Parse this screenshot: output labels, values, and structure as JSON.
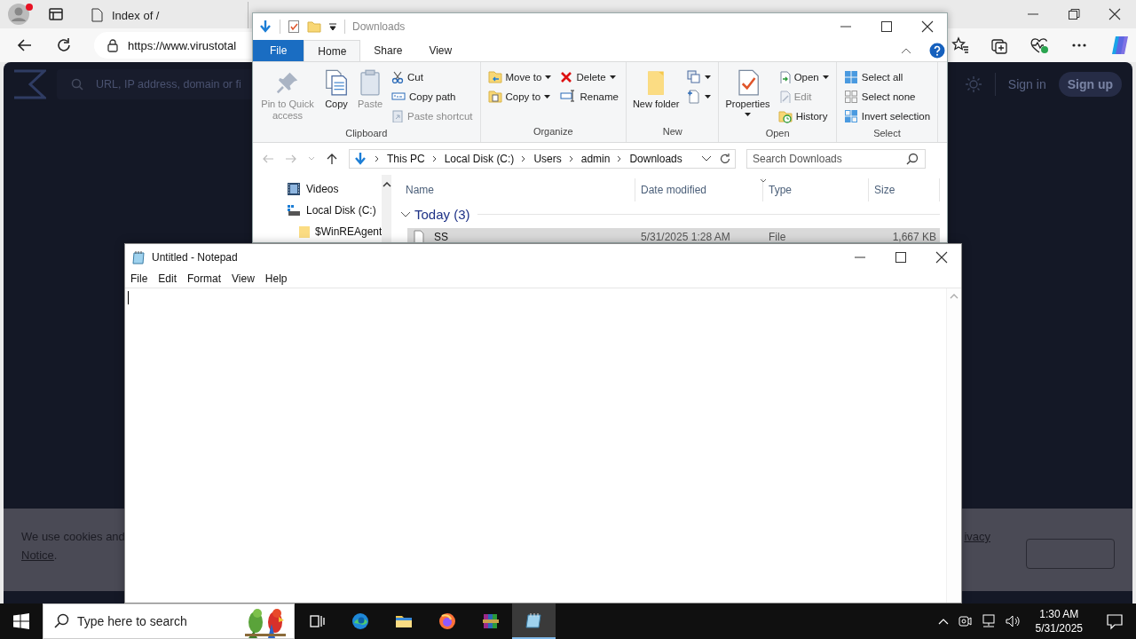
{
  "browser": {
    "tabs": [
      {
        "title": "Index of /",
        "selected": false
      }
    ],
    "address": "https://www.virustotal",
    "page": {
      "search_placeholder": "URL, IP address, domain or fi",
      "sign_in": "Sign in",
      "sign_up": "Sign up",
      "cookie": {
        "text": "We use cookies and",
        "link": "Notice",
        "after_link": ".",
        "right_link": "ivacy"
      }
    }
  },
  "explorer": {
    "title": "Downloads",
    "ribbon_tabs": [
      {
        "label": "File",
        "kind": "file",
        "selected": false
      },
      {
        "label": "Home",
        "kind": "tab",
        "selected": true
      },
      {
        "label": "Share",
        "kind": "tab",
        "selected": false
      },
      {
        "label": "View",
        "kind": "tab",
        "selected": false
      }
    ],
    "groups": [
      {
        "name": "Clipboard",
        "items": [
          {
            "kind": "large",
            "label": "Pin to Quick access",
            "disabled": true
          },
          {
            "kind": "large",
            "label": "Copy",
            "disabled": false
          },
          {
            "kind": "large",
            "label": "Paste",
            "disabled": true
          },
          {
            "kind": "stack",
            "items": [
              {
                "label": "Cut",
                "disabled": false
              },
              {
                "label": "Copy path",
                "disabled": false
              },
              {
                "label": "Paste shortcut",
                "disabled": true
              }
            ]
          }
        ]
      },
      {
        "name": "Organize",
        "items": [
          {
            "kind": "stack",
            "items": [
              {
                "label": "Move to",
                "dropdown": true
              },
              {
                "label": "Copy to",
                "dropdown": true
              }
            ]
          },
          {
            "kind": "stack",
            "items": [
              {
                "label": "Delete",
                "dropdown": true
              },
              {
                "label": "Rename"
              }
            ]
          }
        ]
      },
      {
        "name": "New",
        "items": [
          {
            "kind": "large",
            "label": "New folder",
            "disabled": false
          },
          {
            "kind": "stack",
            "items": [
              {
                "dropdown": true
              },
              {
                "dropdown": true
              }
            ]
          }
        ]
      },
      {
        "name": "Open",
        "items": [
          {
            "kind": "large",
            "label": "Properties",
            "dropdown": true,
            "disabled": false
          },
          {
            "kind": "stack",
            "items": [
              {
                "label": "Open",
                "dropdown": true
              },
              {
                "label": "Edit",
                "disabled": true
              },
              {
                "label": "History"
              }
            ]
          }
        ]
      },
      {
        "name": "Select",
        "items": [
          {
            "kind": "stack",
            "items": [
              {
                "label": "Select all"
              },
              {
                "label": "Select none"
              },
              {
                "label": "Invert selection"
              }
            ]
          }
        ]
      }
    ],
    "path": [
      "This PC",
      "Local Disk (C:)",
      "Users",
      "admin",
      "Downloads"
    ],
    "search_placeholder": "Search Downloads",
    "nav": [
      {
        "label": "Videos"
      },
      {
        "label": "Local Disk (C:)",
        "children": [
          {
            "label": "$WinREAgent"
          }
        ]
      }
    ],
    "columns": [
      {
        "label": "Name",
        "sorted": false
      },
      {
        "label": "Date modified",
        "sorted": true
      },
      {
        "label": "Type",
        "sorted": false
      },
      {
        "label": "Size",
        "sorted": false
      }
    ],
    "file_groups": [
      {
        "label": "Today (3)",
        "expanded": true,
        "rows": [
          {
            "name": "SS",
            "date": "5/31/2025 1:28 AM",
            "type": "File",
            "size": "1,667 KB",
            "selected": true
          }
        ]
      }
    ]
  },
  "notepad": {
    "title": "Untitled - Notepad",
    "menus": [
      "File",
      "Edit",
      "Format",
      "View",
      "Help"
    ]
  },
  "taskbar": {
    "search_placeholder": "Type here to search",
    "apps": [
      {
        "active": false
      },
      {
        "active": false
      },
      {
        "active": false
      },
      {
        "active": false
      },
      {
        "active": false
      },
      {
        "active": true
      }
    ],
    "time": "1:30 AM",
    "date": "5/31/2025"
  }
}
